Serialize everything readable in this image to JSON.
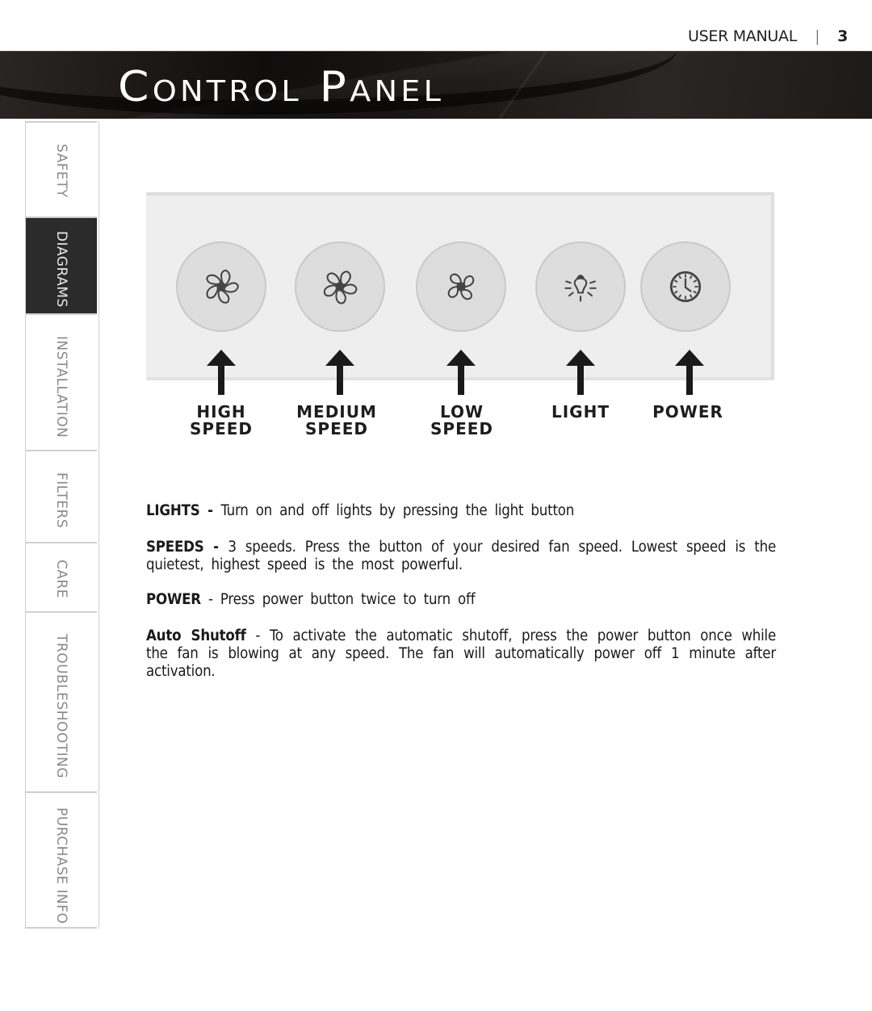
{
  "header": {
    "manual_label": "USER MANUAL",
    "separator": "|",
    "page_number": "3"
  },
  "banner": {
    "title": "Control Panel"
  },
  "sidebar": {
    "items": [
      {
        "label": "SAFETY",
        "active": false
      },
      {
        "label": "DIAGRAMS",
        "active": true
      },
      {
        "label": "INSTALLATION",
        "active": false
      },
      {
        "label": "FILTERS",
        "active": false
      },
      {
        "label": "CARE",
        "active": false
      },
      {
        "label": "TROUBLESHOOTING",
        "active": false
      },
      {
        "label": "PURCHASE  INFO",
        "active": false
      }
    ]
  },
  "control_panel": {
    "buttons": [
      {
        "icon": "fan-high-icon",
        "label_line1": "HIGH",
        "label_line2": "SPEED"
      },
      {
        "icon": "fan-medium-icon",
        "label_line1": "MEDIUM",
        "label_line2": "SPEED"
      },
      {
        "icon": "fan-low-icon",
        "label_line1": "LOW",
        "label_line2": "SPEED"
      },
      {
        "icon": "light-bulb-icon",
        "label_line1": "LIGHT",
        "label_line2": ""
      },
      {
        "icon": "clock-icon",
        "label_line1": "POWER",
        "label_line2": ""
      }
    ]
  },
  "descriptions": [
    {
      "term": "LIGHTS",
      "dash": " - ",
      "text": "Turn on and off lights by pressing the light button"
    },
    {
      "term": "SPEEDS",
      "dash": " - ",
      "text": "3 speeds. Press the button of your desired fan speed. Lowest speed is the quietest, highest speed is the most powerful."
    },
    {
      "term": "POWER",
      "dash": " - ",
      "text": "Press power button twice to turn off"
    },
    {
      "term": "Auto Shutoff",
      "dash": " - ",
      "text": "To activate the automatic shutoff, press the power button once while the fan is blowing at any speed. The fan will automatically power off 1 minute after activation."
    }
  ]
}
